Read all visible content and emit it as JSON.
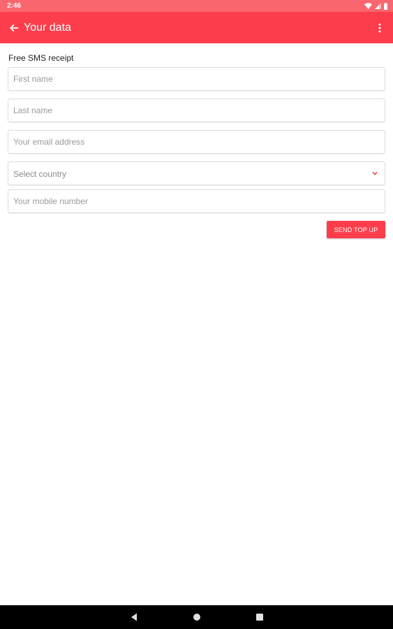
{
  "status_bar": {
    "time": "2:46",
    "icons": [
      "wifi-icon",
      "signal-icon",
      "battery-icon"
    ]
  },
  "app_bar": {
    "title": "Your data",
    "back_icon": "arrow-left-icon",
    "menu_icon": "more-vert-icon"
  },
  "form": {
    "section_label": "Free SMS receipt",
    "first_name": {
      "value": "",
      "placeholder": "First name"
    },
    "last_name": {
      "value": "",
      "placeholder": "Last name"
    },
    "email": {
      "value": "",
      "placeholder": "Your email address"
    },
    "country": {
      "selected": "Select country"
    },
    "mobile": {
      "value": "",
      "placeholder": "Your mobile number"
    },
    "send_label": "SEND TOP UP"
  },
  "nav_bar": {
    "icons": [
      "nav-back-icon",
      "nav-home-icon",
      "nav-recents-icon"
    ]
  },
  "colors": {
    "status_bar": "#f9666e",
    "app_bar": "#fc3e4c",
    "accent": "#fc3e4c",
    "chevron": "#e53935"
  }
}
